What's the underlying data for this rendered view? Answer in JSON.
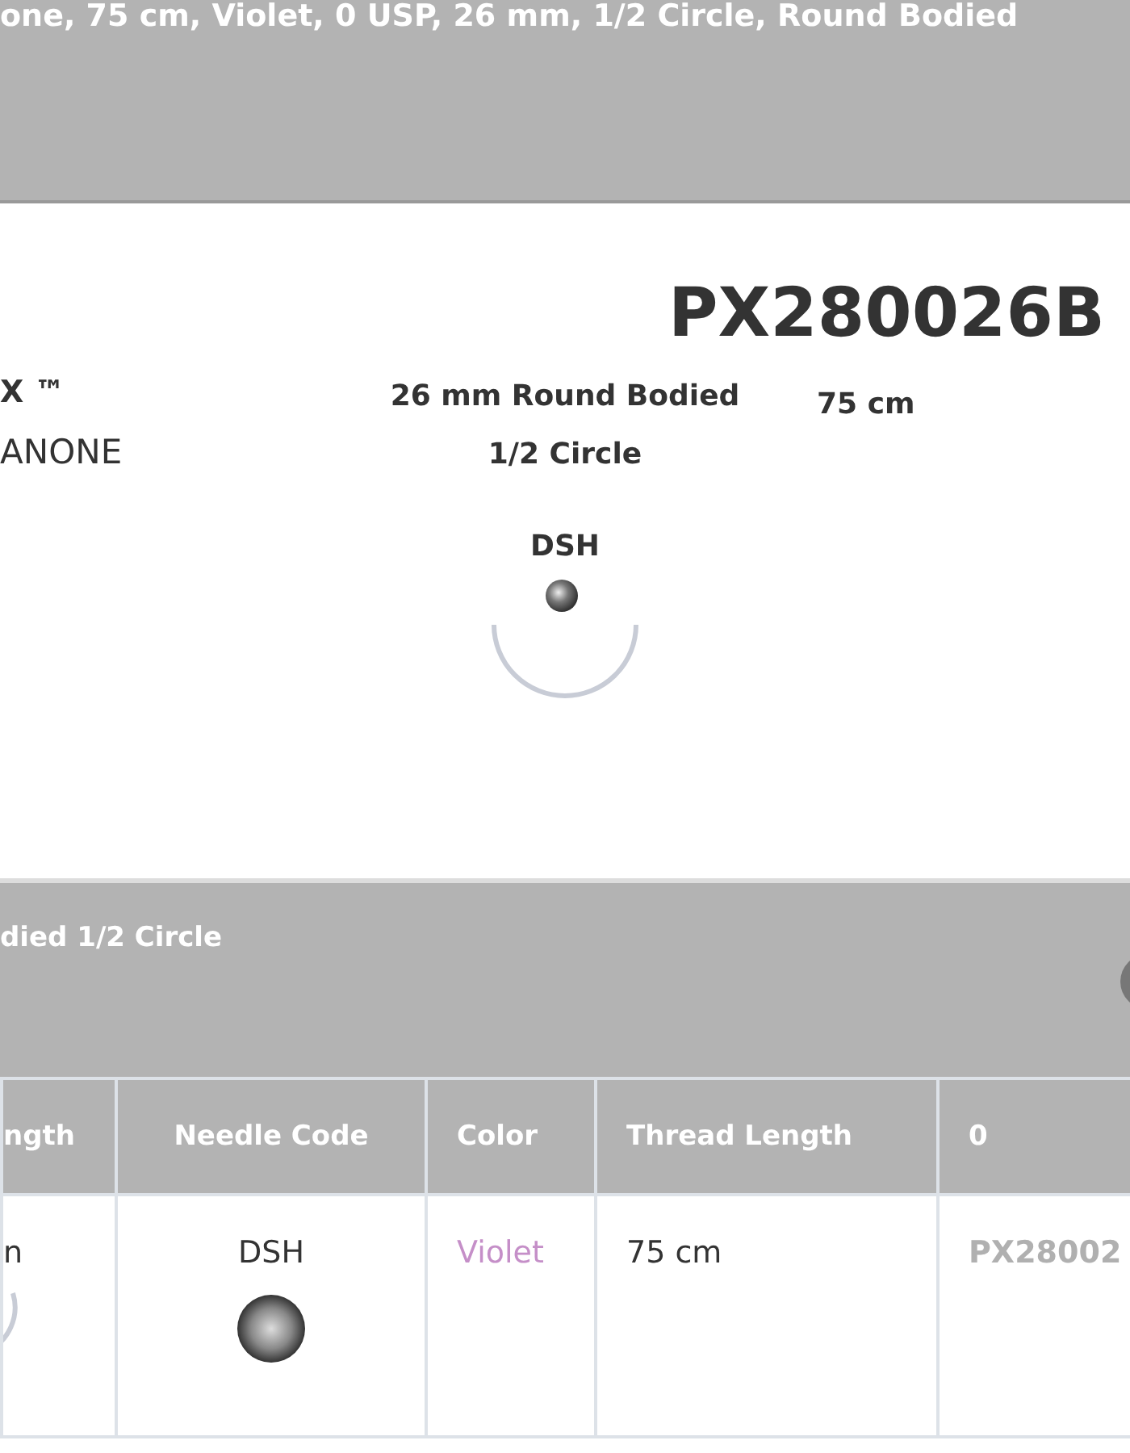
{
  "banner": {
    "title": "one, 75 cm, Violet, 0 USP, 26 mm, 1/2 Circle, Round Bodied"
  },
  "product": {
    "code": "PX280026B",
    "brand": "X ™",
    "material": "ANONE",
    "needle_spec": [
      "26 mm Round Bodied",
      "1/2 Circle"
    ],
    "length": "75 cm",
    "needle_code": "DSH"
  },
  "section": {
    "title": "died 1/2 Circle"
  },
  "table": {
    "columns": [
      "ngth",
      "Needle Code",
      "Color",
      "Thread Length",
      "0"
    ],
    "rows": [
      {
        "column_1": "n",
        "needle_code": "DSH",
        "color_name": "Violet",
        "thread_length": "75 cm",
        "code": "PX28002"
      }
    ]
  }
}
